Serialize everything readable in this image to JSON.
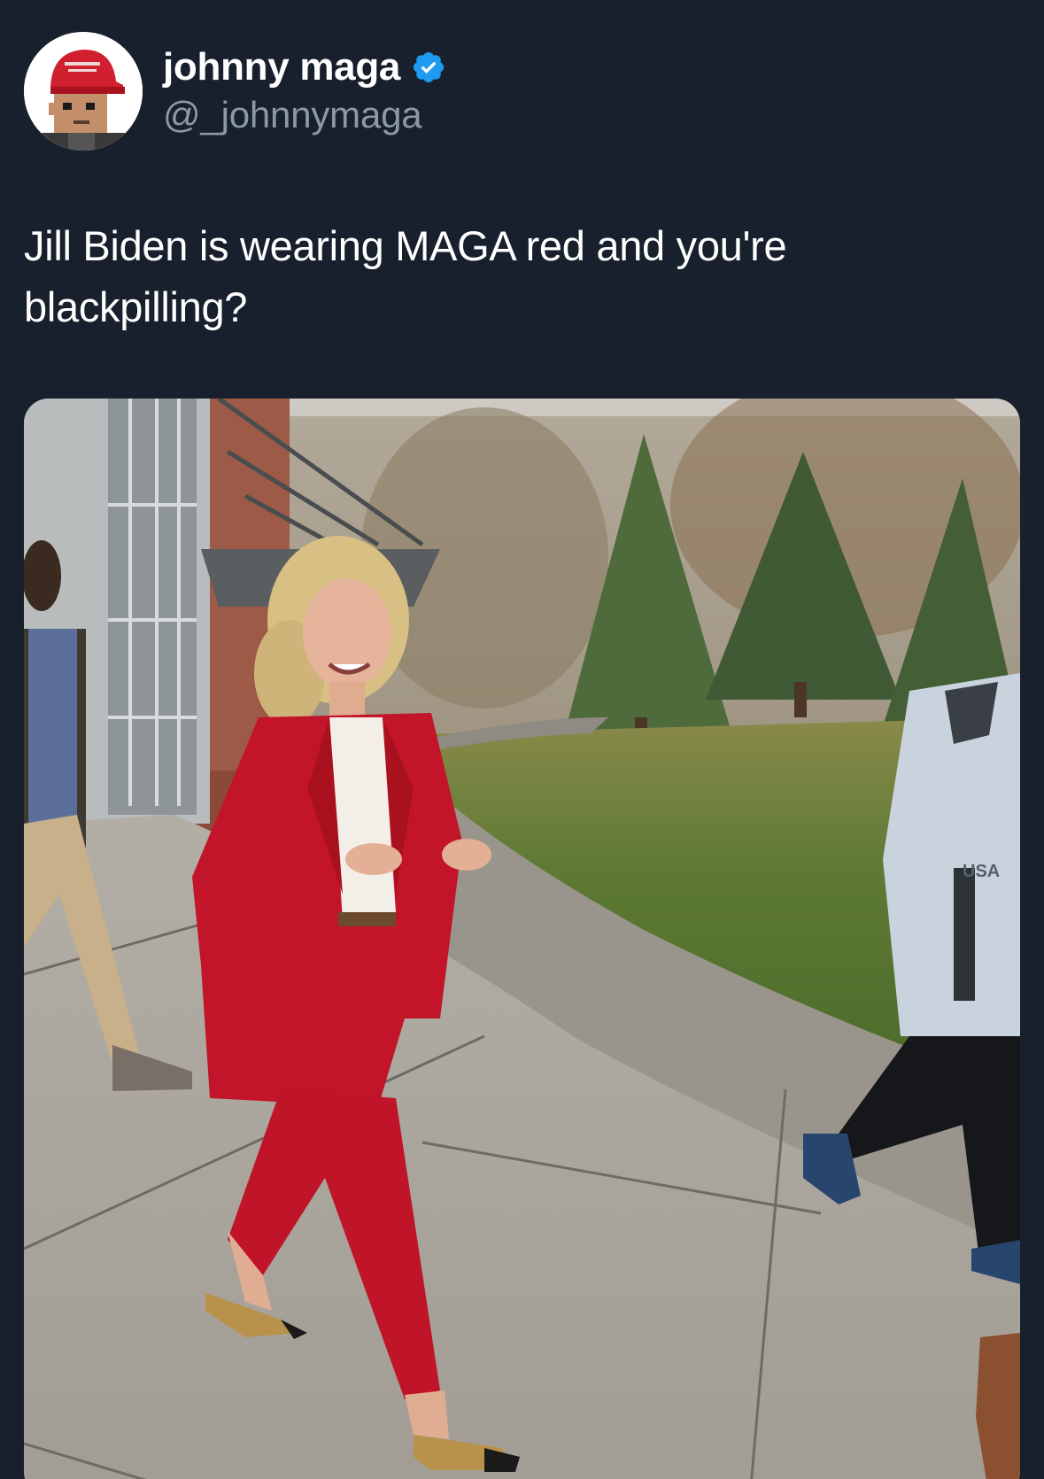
{
  "author": {
    "display_name": "johnny maga",
    "handle": "@_johnnymaga",
    "verified": true,
    "verified_color": "#1d9bf0",
    "avatar_icon": "pixel-art-avatar-red-hat"
  },
  "tweet": {
    "text": "Jill Biden is wearing MAGA red and you're blackpilling?"
  },
  "media": {
    "type": "photo",
    "jacket_text": "USA"
  },
  "colors": {
    "background": "#17202c",
    "text_primary": "#ffffff",
    "text_secondary": "#8b98a5",
    "suit_red": "#c3152a"
  }
}
